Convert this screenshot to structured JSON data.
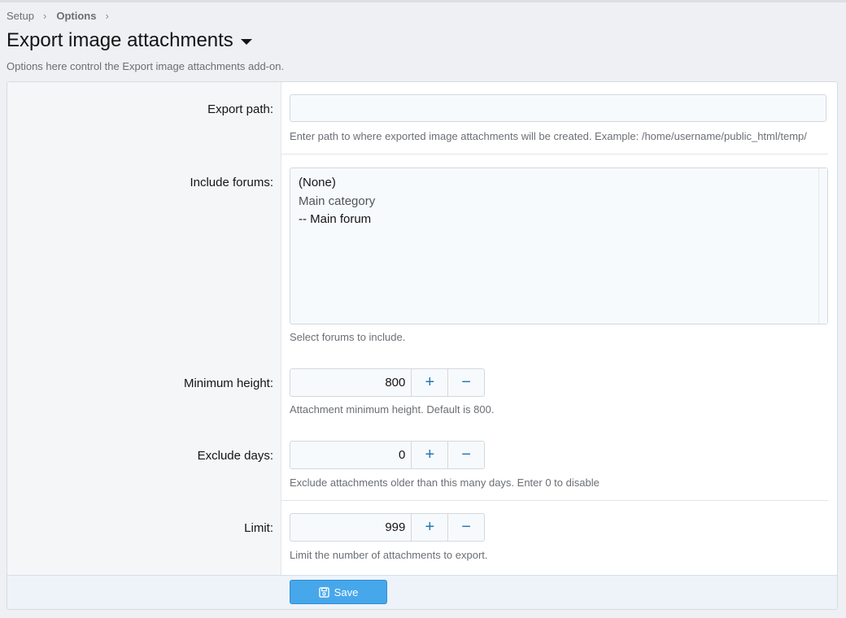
{
  "breadcrumb": {
    "items": [
      "Setup",
      "Options"
    ]
  },
  "header": {
    "title": "Export image attachments",
    "description": "Options here control the Export image attachments add-on."
  },
  "form": {
    "export_path": {
      "label": "Export path:",
      "value": "",
      "hint": "Enter path to where exported image attachments will be created. Example: /home/username/public_html/temp/"
    },
    "include_forums": {
      "label": "Include forums:",
      "options": [
        "(None)",
        "Main category",
        "-- Main forum"
      ],
      "hint": "Select forums to include."
    },
    "minimum_height": {
      "label": "Minimum height:",
      "value": "800",
      "plus": "+",
      "minus": "−",
      "hint": "Attachment minimum height. Default is 800."
    },
    "exclude_days": {
      "label": "Exclude days:",
      "value": "0",
      "plus": "+",
      "minus": "−",
      "hint": "Exclude attachments older than this many days. Enter 0 to disable"
    },
    "limit": {
      "label": "Limit:",
      "value": "999",
      "plus": "+",
      "minus": "−",
      "hint": "Limit the number of attachments to export."
    }
  },
  "footer": {
    "save_label": "Save",
    "save_icon": "save-icon"
  },
  "colors": {
    "accent": "#47a7eb",
    "link": "#2577b1",
    "label_bg": "#f5f6f7"
  }
}
